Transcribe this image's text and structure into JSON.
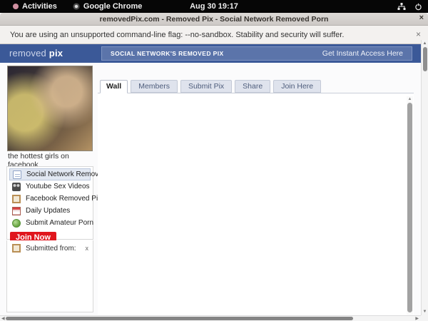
{
  "desktop": {
    "activities_label": "Activities",
    "app_label": "Google Chrome",
    "clock": "Aug 30 19:17"
  },
  "window": {
    "title": "removedPix.com - Removed Pix - Social Network Removed Porn",
    "close_glyph": "×"
  },
  "notice": {
    "message": "You are using an unsupported command-line flag: --no-sandbox. Stability and security will suffer.",
    "close_glyph": "×"
  },
  "site": {
    "logo_light": "removed ",
    "logo_bold": "pix",
    "banner_text": "SOCIAL NETWORK'S REMOVED PIX",
    "cta_label": "Get Instant Access Here"
  },
  "sidebar": {
    "photo_caption": "the hottest girls on facebook",
    "menu": [
      {
        "label": "Social Network Removed Porn",
        "icon": "notes-icon",
        "active": true
      },
      {
        "label": "Youtube Sex Videos",
        "icon": "video-camera-icon",
        "active": false
      },
      {
        "label": "Facebook Removed Pics",
        "icon": "photo-frame-icon",
        "active": false
      },
      {
        "label": "Daily Updates",
        "icon": "calendar-icon",
        "active": false
      },
      {
        "label": "Submit Amateur Porn",
        "icon": "camera-icon",
        "active": false
      }
    ],
    "join_button_label": "Join Now",
    "submitted_from_label": "Submitted from:",
    "submitted_close_glyph": "x"
  },
  "tabs": [
    {
      "label": "Wall",
      "active": true
    },
    {
      "label": "Members",
      "active": false
    },
    {
      "label": "Submit Pix",
      "active": false
    },
    {
      "label": "Share",
      "active": false
    },
    {
      "label": "Join Here",
      "active": false
    }
  ],
  "icons": {
    "scroll_up": "▲",
    "scroll_down": "▼",
    "scroll_left": "◀",
    "scroll_right": "▶"
  },
  "colors": {
    "header_blue": "#3b5998",
    "inner_bar_blue": "#5b74aa",
    "join_red": "#e0161d",
    "active_item_bg": "#e2e8f2",
    "tab_inactive_bg": "#dfe3ed"
  }
}
